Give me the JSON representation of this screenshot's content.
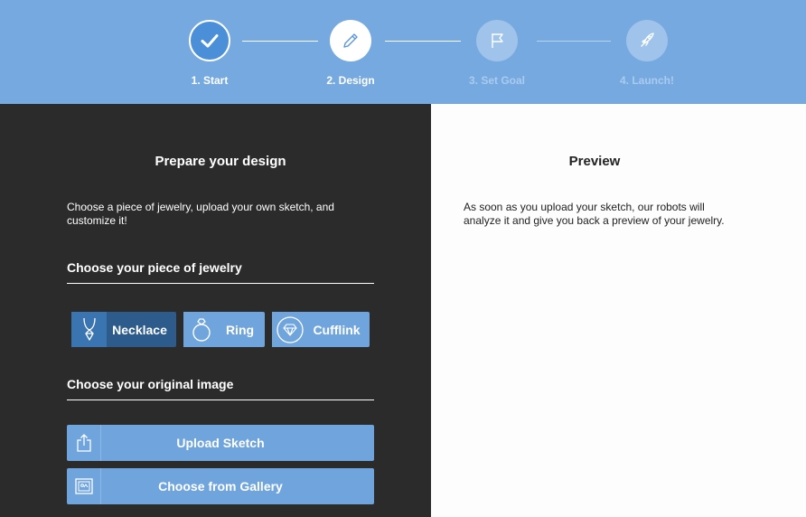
{
  "stepper": {
    "steps": [
      {
        "label": "1. Start",
        "state": "done",
        "icon": "check-icon"
      },
      {
        "label": "2. Design",
        "state": "active",
        "icon": "pencil-icon"
      },
      {
        "label": "3. Set Goal",
        "state": "pending",
        "icon": "flag-icon"
      },
      {
        "label": "4. Launch!",
        "state": "pending",
        "icon": "rocket-icon"
      }
    ]
  },
  "left": {
    "title": "Prepare your design",
    "intro": "Choose a piece of jewelry, upload your own sketch, and customize it!",
    "jewelry_heading": "Choose your piece of jewelry",
    "jewelry": [
      {
        "label": "Necklace",
        "icon": "necklace-icon",
        "selected": true
      },
      {
        "label": "Ring",
        "icon": "ring-icon",
        "selected": false
      },
      {
        "label": "Cufflink",
        "icon": "cufflink-icon",
        "selected": false
      }
    ],
    "image_heading": "Choose your original image",
    "upload_label": "Upload Sketch",
    "gallery_label": "Choose from Gallery"
  },
  "right": {
    "title": "Preview",
    "text": "As soon as you upload your sketch, our robots will analyze it and give you back a preview of your jewelry."
  },
  "colors": {
    "header": "#76a9e0",
    "dark_panel": "#2b2b2b",
    "button": "#6fa4dd",
    "button_selected": "#2c5b8c"
  }
}
